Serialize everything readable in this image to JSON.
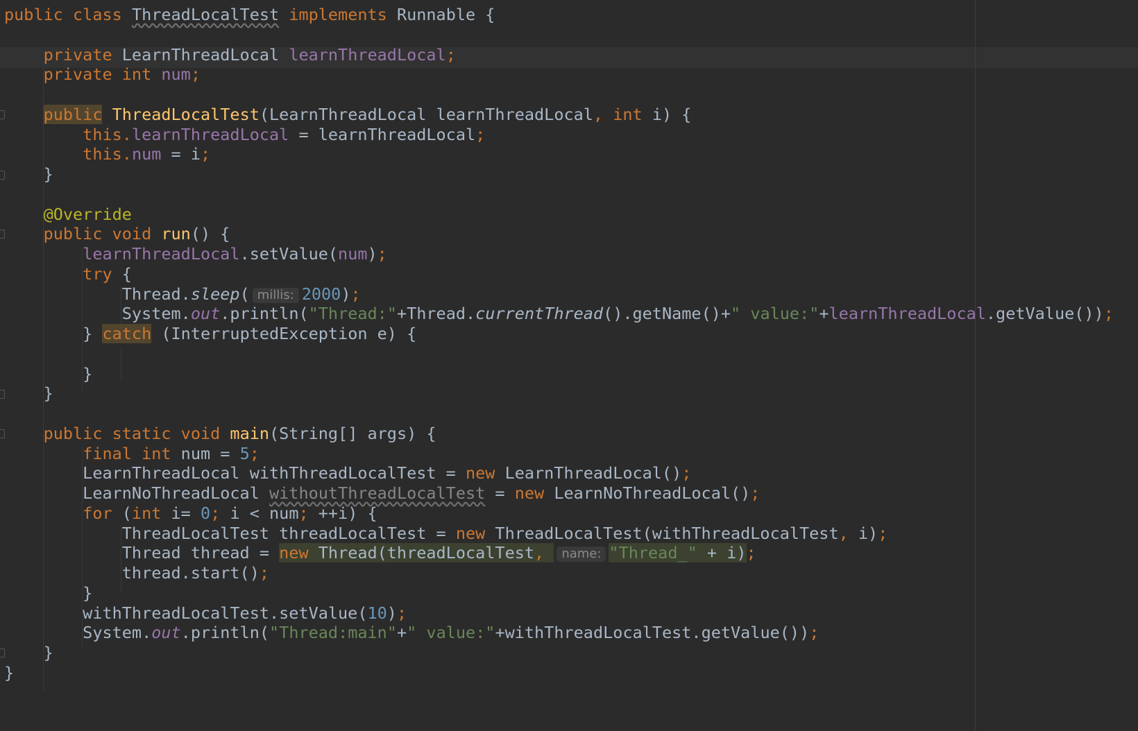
{
  "editor": {
    "lines": [
      [
        {
          "t": "public class ",
          "c": "kw"
        },
        {
          "t": "ThreadLocalTest",
          "c": "ul"
        },
        {
          "t": " implements ",
          "c": "kw"
        },
        {
          "t": "Runnable {",
          "c": ""
        }
      ],
      [],
      [
        {
          "t": "    private ",
          "c": "kw"
        },
        {
          "t": "LearnThreadLocal ",
          "c": ""
        },
        {
          "t": "learnThreadLocal",
          "c": "fld"
        },
        {
          "t": ";",
          "c": "kw"
        }
      ],
      [
        {
          "t": "    private int ",
          "c": "kw"
        },
        {
          "t": "num",
          "c": "fld"
        },
        {
          "t": ";",
          "c": "kw"
        }
      ],
      [],
      [
        {
          "t": "    ",
          "c": ""
        },
        {
          "t": "public",
          "c": "kw hl-kw"
        },
        {
          "t": " ",
          "c": ""
        },
        {
          "t": "ThreadLocalTest",
          "c": "fn"
        },
        {
          "t": "(LearnThreadLocal learnThreadLocal",
          "c": ""
        },
        {
          "t": ", int ",
          "c": "kw"
        },
        {
          "t": "i) {",
          "c": ""
        }
      ],
      [
        {
          "t": "        this.",
          "c": "kw"
        },
        {
          "t": "learnThreadLocal",
          "c": "fld"
        },
        {
          "t": " = learnThreadLocal",
          "c": ""
        },
        {
          "t": ";",
          "c": "kw"
        }
      ],
      [
        {
          "t": "        this.",
          "c": "kw"
        },
        {
          "t": "num",
          "c": "fld"
        },
        {
          "t": " = i",
          "c": ""
        },
        {
          "t": ";",
          "c": "kw"
        }
      ],
      [
        {
          "t": "    }",
          "c": ""
        }
      ],
      [],
      [
        {
          "t": "    @Override",
          "c": "ann"
        }
      ],
      [
        {
          "t": "    public void ",
          "c": "kw"
        },
        {
          "t": "run",
          "c": "fn"
        },
        {
          "t": "() {",
          "c": ""
        }
      ],
      [
        {
          "t": "        ",
          "c": ""
        },
        {
          "t": "learnThreadLocal",
          "c": "fld"
        },
        {
          "t": ".setValue(",
          "c": ""
        },
        {
          "t": "num",
          "c": "fld"
        },
        {
          "t": ")",
          "c": ""
        },
        {
          "t": ";",
          "c": "kw"
        }
      ],
      [
        {
          "t": "        try ",
          "c": "kw"
        },
        {
          "t": "{",
          "c": ""
        }
      ],
      [
        {
          "t": "            Thread.",
          "c": ""
        },
        {
          "t": "sleep",
          "c": "it"
        },
        {
          "t": "(",
          "c": ""
        },
        {
          "t": "millis:",
          "c": "hint"
        },
        {
          "t": "2000",
          "c": "num"
        },
        {
          "t": ")",
          "c": ""
        },
        {
          "t": ";",
          "c": "kw"
        }
      ],
      [
        {
          "t": "            System.",
          "c": ""
        },
        {
          "t": "out",
          "c": "fld it"
        },
        {
          "t": ".println(",
          "c": ""
        },
        {
          "t": "\"Thread:\"",
          "c": "str"
        },
        {
          "t": "+Thread.",
          "c": ""
        },
        {
          "t": "currentThread",
          "c": "it"
        },
        {
          "t": "().getName()+",
          "c": ""
        },
        {
          "t": "\" value:\"",
          "c": "str"
        },
        {
          "t": "+",
          "c": ""
        },
        {
          "t": "learnThreadLocal",
          "c": "fld"
        },
        {
          "t": ".getValue())",
          "c": ""
        },
        {
          "t": ";",
          "c": "kw"
        }
      ],
      [
        {
          "t": "        } ",
          "c": ""
        },
        {
          "t": "catch",
          "c": "kw hl-kw"
        },
        {
          "t": " (InterruptedException e) {",
          "c": ""
        }
      ],
      [],
      [
        {
          "t": "        }",
          "c": ""
        }
      ],
      [
        {
          "t": "    }",
          "c": ""
        }
      ],
      [],
      [
        {
          "t": "    public static void ",
          "c": "kw"
        },
        {
          "t": "main",
          "c": "fn"
        },
        {
          "t": "(String[] args) {",
          "c": ""
        }
      ],
      [
        {
          "t": "        final int ",
          "c": "kw"
        },
        {
          "t": "num = ",
          "c": ""
        },
        {
          "t": "5",
          "c": "num"
        },
        {
          "t": ";",
          "c": "kw"
        }
      ],
      [
        {
          "t": "        LearnThreadLocal withThreadLocalTest = ",
          "c": ""
        },
        {
          "t": "new ",
          "c": "kw"
        },
        {
          "t": "LearnThreadLocal()",
          "c": ""
        },
        {
          "t": ";",
          "c": "kw"
        }
      ],
      [
        {
          "t": "        LearnNoThreadLocal ",
          "c": ""
        },
        {
          "t": "withoutThreadLocalTest",
          "c": "unused ul"
        },
        {
          "t": " = ",
          "c": ""
        },
        {
          "t": "new ",
          "c": "kw"
        },
        {
          "t": "LearnNoThreadLocal()",
          "c": ""
        },
        {
          "t": ";",
          "c": "kw"
        }
      ],
      [
        {
          "t": "        for ",
          "c": "kw"
        },
        {
          "t": "(",
          "c": ""
        },
        {
          "t": "int ",
          "c": "kw"
        },
        {
          "t": "i= ",
          "c": ""
        },
        {
          "t": "0",
          "c": "num"
        },
        {
          "t": "; ",
          "c": "kw"
        },
        {
          "t": "i < num",
          "c": ""
        },
        {
          "t": "; ",
          "c": "kw"
        },
        {
          "t": "++i) {",
          "c": ""
        }
      ],
      [
        {
          "t": "            ThreadLocalTest threadLocalTest = ",
          "c": ""
        },
        {
          "t": "new ",
          "c": "kw"
        },
        {
          "t": "ThreadLocalTest(withThreadLocalTest",
          "c": ""
        },
        {
          "t": ", ",
          "c": "kw"
        },
        {
          "t": "i)",
          "c": ""
        },
        {
          "t": ";",
          "c": "kw"
        }
      ],
      [
        {
          "t": "            Thread thread = ",
          "c": ""
        },
        {
          "t": "new ",
          "c": "kw hl-expr"
        },
        {
          "t": "Thread(threadLocalTest",
          "c": "hl-expr"
        },
        {
          "t": ", ",
          "c": "kw hl-expr"
        },
        {
          "t": "name:",
          "c": "hint"
        },
        {
          "t": "\"Thread_\"",
          "c": "str hl-expr"
        },
        {
          "t": " + i)",
          "c": "hl-expr"
        },
        {
          "t": ";",
          "c": "kw"
        }
      ],
      [
        {
          "t": "            thread.start()",
          "c": ""
        },
        {
          "t": ";",
          "c": "kw"
        }
      ],
      [
        {
          "t": "        }",
          "c": ""
        }
      ],
      [
        {
          "t": "        withThreadLocalTest.setValue(",
          "c": ""
        },
        {
          "t": "10",
          "c": "num"
        },
        {
          "t": ")",
          "c": ""
        },
        {
          "t": ";",
          "c": "kw"
        }
      ],
      [
        {
          "t": "        System.",
          "c": ""
        },
        {
          "t": "out",
          "c": "fld it"
        },
        {
          "t": ".println(",
          "c": ""
        },
        {
          "t": "\"Thread:main\"",
          "c": "str"
        },
        {
          "t": "+",
          "c": ""
        },
        {
          "t": "\" value:\"",
          "c": "str"
        },
        {
          "t": "+withThreadLocalTest.getValue())",
          "c": ""
        },
        {
          "t": ";",
          "c": "kw"
        }
      ],
      [
        {
          "t": "    }",
          "c": ""
        }
      ],
      [
        {
          "t": "}",
          "c": ""
        }
      ]
    ]
  }
}
